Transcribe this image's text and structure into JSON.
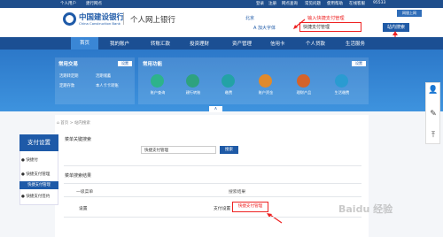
{
  "topbar": {
    "account": "个人用户",
    "brand": "建行网点",
    "links": [
      "登录",
      "注册",
      "网点查询",
      "常见问题",
      "使用帮助",
      "在线客服"
    ],
    "phone": "95533",
    "app": "网银上网"
  },
  "header": {
    "bank_cn": "中国建设银行",
    "bank_en": "China Construction Bank",
    "site_title": "个人网上银行",
    "location": "北京",
    "font_button": "A 加大字体",
    "search_value": "快捷支付管理",
    "search_button": "站内搜索",
    "annotation_hint": "输入快捷支付管理"
  },
  "nav": {
    "items": [
      "首页",
      "我的账户",
      "转账汇款",
      "投资理财",
      "资产管理",
      "信用卡",
      "个人贷款",
      "生活服务"
    ]
  },
  "hero": {
    "panel1": {
      "title": "常用交易",
      "button": "设置",
      "links": [
        "活期转定期",
        "活期储蓄",
        "定期存款",
        "本人卡卡转账"
      ]
    },
    "panel2": {
      "title": "常用功能",
      "button": "设置",
      "items": [
        "账户查询",
        "建行转账",
        "缴费",
        "账户资金",
        "理财产品",
        "生活缴费"
      ]
    },
    "fold": "∧"
  },
  "breadcrumb": {
    "home": "首页",
    "current": "站内搜索"
  },
  "sidebar": {
    "title": "支付设置",
    "items": [
      "快捷付",
      "快捷支付管理",
      "快捷支付签约"
    ],
    "selected": "快捷支付管理"
  },
  "search_section": {
    "title": "菜单关键搜索",
    "input_value": "快捷支付管理",
    "button": "搜索"
  },
  "results": {
    "title": "菜单搜索结果",
    "headers": [
      "一级菜单",
      "搜索结果"
    ],
    "rows": [
      {
        "menu": "设置",
        "path": "支付设置",
        "result": "快捷支付管理"
      }
    ]
  },
  "watermark": "Baidu 经验",
  "colors": {
    "brand_blue": "#1e5aa8",
    "nav_blue": "#1b4f93",
    "annotation_red": "#e22222"
  }
}
